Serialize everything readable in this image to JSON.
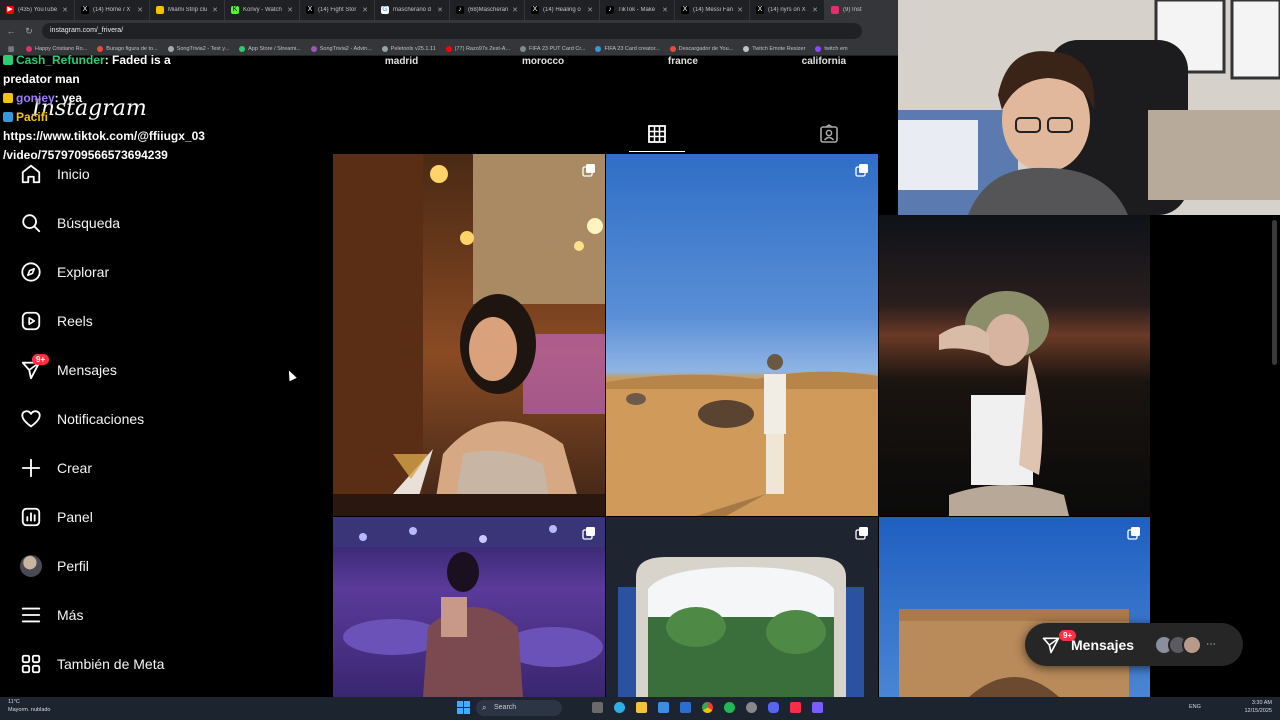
{
  "browser": {
    "tabs": [
      {
        "title": "(435) YouTube",
        "color": "#ff0000"
      },
      {
        "title": "(14) Home / X",
        "color": "#000000"
      },
      {
        "title": "Miami Strip clu",
        "color": "#f5c400"
      },
      {
        "title": "Konvy - Watch",
        "color": "#53fc18"
      },
      {
        "title": "(14) Fight Stor",
        "color": "#000000"
      },
      {
        "title": "mascherano d",
        "color": "#4285f4"
      },
      {
        "title": "(68)Mascheran",
        "color": "#000000"
      },
      {
        "title": "(14) Healing o",
        "color": "#000000"
      },
      {
        "title": "TikTok - Make",
        "color": "#000000"
      },
      {
        "title": "(14) Messi Fan",
        "color": "#000000"
      },
      {
        "title": "(14) nyrs on X",
        "color": "#000000"
      },
      {
        "title": "(9) Inst",
        "color": "#e1306c"
      }
    ],
    "url": "instagram.com/_frivera/",
    "bookmarks": [
      {
        "label": "Happy Cristiano Ro...",
        "color": "#e1306c"
      },
      {
        "label": "Burago figura de to...",
        "color": "#e74c3c"
      },
      {
        "label": "SongTrivia2 - Test y...",
        "color": "#aaaaaa"
      },
      {
        "label": "App Store / Streami...",
        "color": "#2ecc71"
      },
      {
        "label": "SongTrivia2 - Advin...",
        "color": "#9b59b6"
      },
      {
        "label": "Peletools v25.1.11",
        "color": "#95a5a6"
      },
      {
        "label": "(77) Razo97s Zest-A...",
        "color": "#ff0000"
      },
      {
        "label": "FIFA 23 PUT Card Cr...",
        "color": "#7f8c8d"
      },
      {
        "label": "FIFA 23 Card creator...",
        "color": "#3498db"
      },
      {
        "label": "Descargador de You...",
        "color": "#e74c3c"
      },
      {
        "label": "Twitch Emote Resizer",
        "color": "#bdc3c7"
      },
      {
        "label": "twitch em",
        "color": "#9146ff"
      }
    ]
  },
  "profile": {
    "highlights": [
      "madrid",
      "morocco",
      "france",
      "california"
    ]
  },
  "sidebar": {
    "logo": "Instagram",
    "items": [
      {
        "label": "Inicio",
        "icon": "home-icon"
      },
      {
        "label": "Búsqueda",
        "icon": "search-icon"
      },
      {
        "label": "Explorar",
        "icon": "compass-icon"
      },
      {
        "label": "Reels",
        "icon": "reels-icon"
      },
      {
        "label": "Mensajes",
        "icon": "messenger-icon",
        "badge": "9+"
      },
      {
        "label": "Notificaciones",
        "icon": "heart-icon"
      },
      {
        "label": "Crear",
        "icon": "plus-icon"
      },
      {
        "label": "Panel",
        "icon": "chart-icon"
      },
      {
        "label": "Perfil",
        "icon": "avatar"
      },
      {
        "label": "Más",
        "icon": "menu-icon"
      },
      {
        "label": "También de Meta",
        "icon": "meta-apps-icon"
      }
    ]
  },
  "chat": {
    "lines": [
      {
        "user": "Cash_Refunder",
        "text": ": Faded is a"
      },
      {
        "user": "",
        "text": "predator man"
      },
      {
        "user": "gonjey",
        "text": ": yea"
      },
      {
        "user": "Pacifi",
        "text": ""
      },
      {
        "user": "",
        "text": "https://www.tiktok.com/@ffiiugx_03"
      },
      {
        "user": "",
        "text": "/video/7579709566573694239"
      }
    ]
  },
  "messages_pill": {
    "label": "Mensajes",
    "badge": "9+"
  },
  "taskbar": {
    "weather_temp": "11°C",
    "weather_desc": "Mayorm. nublado",
    "search": "Search",
    "lang": "ENG",
    "time": "3:30 AM",
    "date": "12/15/2025"
  },
  "colors": {
    "accent": "#ff3040",
    "bg": "#000000",
    "text": "#f5f5f5"
  }
}
